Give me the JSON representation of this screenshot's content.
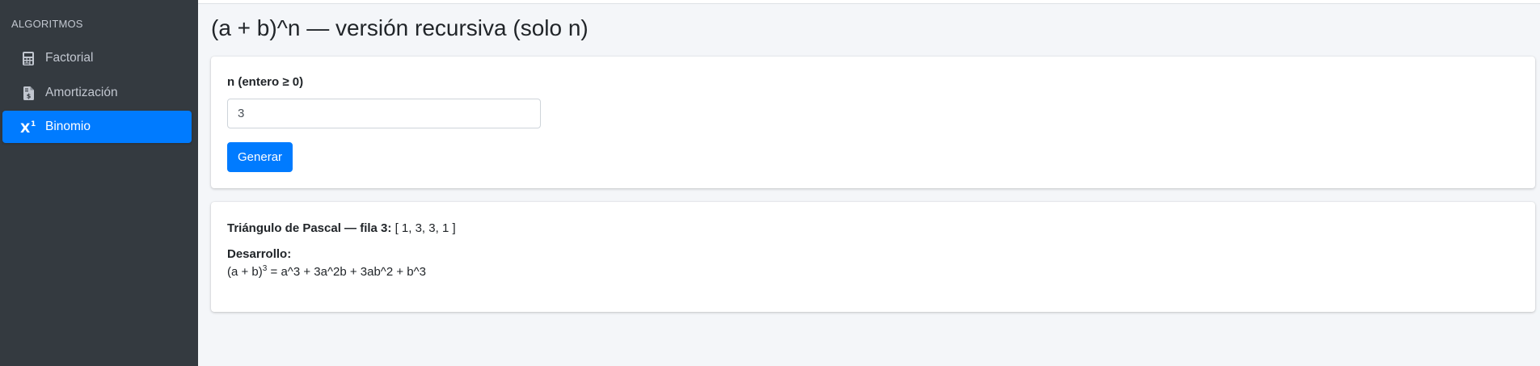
{
  "sidebar": {
    "header": "ALGORITMOS",
    "items": [
      {
        "label": "Factorial",
        "icon": "calculator-icon",
        "active": false
      },
      {
        "label": "Amortización",
        "icon": "file-invoice-dollar-icon",
        "active": false
      },
      {
        "label": "Binomio",
        "icon": "superscript-icon",
        "active": true
      }
    ]
  },
  "page": {
    "title": "(a + b)^n — versión recursiva (solo n)"
  },
  "form": {
    "label": "n (entero ≥ 0)",
    "input_value": "3",
    "submit_label": "Generar"
  },
  "result": {
    "pascal_label": "Triángulo de Pascal — fila 3:",
    "pascal_value": "[ 1, 3, 3, 1 ]",
    "dev_label": "Desarrollo:",
    "dev_base": "(a + b)",
    "dev_exponent": "3",
    "dev_expansion": "= a^3 + 3a^2b + 3ab^2 + b^3"
  },
  "colors": {
    "sidebar_bg": "#343a40",
    "accent": "#007bff",
    "content_bg": "#f4f6f9"
  }
}
